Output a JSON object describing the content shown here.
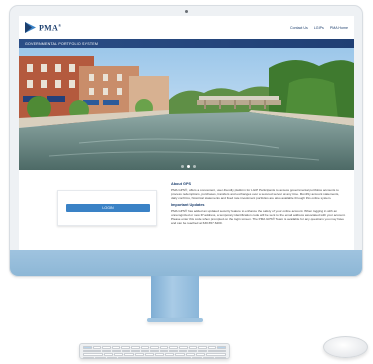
{
  "site": {
    "logo_text": "PMA",
    "logo_tm": "®",
    "nav": [
      "Contact Us",
      "LGIPs",
      "PMA Home"
    ],
    "section_title": "GOVERNMENTAL PORTFOLIO SYSTEM"
  },
  "hero": {
    "slide_count": 3,
    "active_slide": 2
  },
  "login": {
    "button_label": "LOGIN"
  },
  "about": {
    "heading": "About GPS",
    "body": "PMA GPS®, offers a convenient, user-friendly platform for LGIP Participants to access governmental portfolios accounts to process redemptions, purchases, transfers and exchanges over a secured server at any time. Monthly account statements, daily confirms, historical statements and fixed rate investment portfolios are also available through this online system."
  },
  "updates": {
    "heading": "Important Updates",
    "body": "PMA GPS® has added an updated security feature to enhance the safety of your online account. When logging in with an unrecognized or new IP address, a temporary identification code will be sent to the email address associated with your account. Please enter this code when prompted on the login screen. The PMA GPS® Team is available for any questions you may have and can be reached at 630.657.6400."
  },
  "colors": {
    "brand_navy": "#1d3f6e",
    "bar_blue": "#2b4e86",
    "button_blue": "#3a82c6",
    "device_blue": "#9fc3df"
  }
}
